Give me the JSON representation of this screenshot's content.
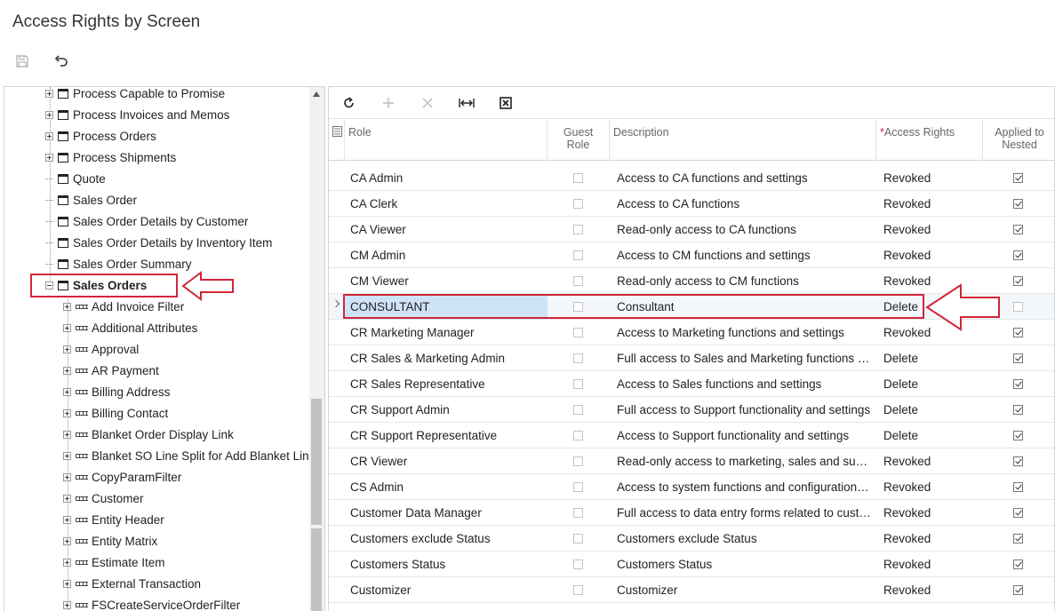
{
  "page": {
    "title": "Access Rights by Screen"
  },
  "toolbar": {
    "save_icon": "save-icon",
    "undo_icon": "undo-icon"
  },
  "tree": {
    "nodes": [
      {
        "label": "Process Capable to Promise",
        "kind": "screen",
        "expander": "plus"
      },
      {
        "label": "Process Invoices and Memos",
        "kind": "screen",
        "expander": "plus"
      },
      {
        "label": "Process Orders",
        "kind": "screen",
        "expander": "plus"
      },
      {
        "label": "Process Shipments",
        "kind": "screen",
        "expander": "plus"
      },
      {
        "label": "Quote",
        "kind": "screen",
        "expander": "none"
      },
      {
        "label": "Sales Order",
        "kind": "screen",
        "expander": "none"
      },
      {
        "label": "Sales Order Details by Customer",
        "kind": "screen",
        "expander": "none"
      },
      {
        "label": "Sales Order Details by Inventory Item",
        "kind": "screen",
        "expander": "none"
      },
      {
        "label": "Sales Order Summary",
        "kind": "screen",
        "expander": "none"
      },
      {
        "label": "Sales Orders",
        "kind": "screen",
        "expander": "minus",
        "selected": true
      },
      {
        "label": "Add Invoice Filter",
        "kind": "field",
        "expander": "plus"
      },
      {
        "label": "Additional Attributes",
        "kind": "field",
        "expander": "plus"
      },
      {
        "label": "Approval",
        "kind": "field",
        "expander": "plus"
      },
      {
        "label": "AR Payment",
        "kind": "field",
        "expander": "plus"
      },
      {
        "label": "Billing Address",
        "kind": "field",
        "expander": "plus"
      },
      {
        "label": "Billing Contact",
        "kind": "field",
        "expander": "plus"
      },
      {
        "label": "Blanket Order Display Link",
        "kind": "field",
        "expander": "plus"
      },
      {
        "label": "Blanket SO Line Split for Add Blanket Line",
        "kind": "field",
        "expander": "plus"
      },
      {
        "label": "CopyParamFilter",
        "kind": "field",
        "expander": "plus"
      },
      {
        "label": "Customer",
        "kind": "field",
        "expander": "plus"
      },
      {
        "label": "Entity Header",
        "kind": "field",
        "expander": "plus"
      },
      {
        "label": "Entity Matrix",
        "kind": "field",
        "expander": "plus"
      },
      {
        "label": "Estimate Item",
        "kind": "field",
        "expander": "plus"
      },
      {
        "label": "External Transaction",
        "kind": "field",
        "expander": "plus"
      },
      {
        "label": "FSCreateServiceOrderFilter",
        "kind": "field",
        "expander": "plus"
      }
    ]
  },
  "grid": {
    "toolbar": [
      "refresh-icon",
      "add-icon",
      "delete-icon",
      "fit-columns-icon",
      "export-excel-icon"
    ],
    "headers": {
      "role": "Role",
      "guest_role": "Guest Role",
      "description": "Description",
      "access_rights_required": "*",
      "access_rights": "Access Rights",
      "applied_to_nested": "Applied to Nested"
    },
    "rows": [
      {
        "role": "CA Admin",
        "guest": false,
        "description": "Access to CA functions and settings",
        "access": "Revoked",
        "nested": true
      },
      {
        "role": "CA Clerk",
        "guest": false,
        "description": "Access to CA functions",
        "access": "Revoked",
        "nested": true
      },
      {
        "role": "CA Viewer",
        "guest": false,
        "description": "Read-only access to CA functions",
        "access": "Revoked",
        "nested": true
      },
      {
        "role": "CM Admin",
        "guest": false,
        "description": "Access to CM functions and settings",
        "access": "Revoked",
        "nested": true
      },
      {
        "role": "CM Viewer",
        "guest": false,
        "description": "Read-only access to CM functions",
        "access": "Revoked",
        "nested": true
      },
      {
        "role": "CONSULTANT",
        "guest": false,
        "description": "Consultant",
        "access": "Delete",
        "nested": false,
        "selected": true
      },
      {
        "role": "CR Marketing Manager",
        "guest": false,
        "description": "Access to Marketing functions and settings",
        "access": "Revoked",
        "nested": true
      },
      {
        "role": "CR Sales & Marketing Admin",
        "guest": false,
        "description": "Full access to Sales and Marketing functions a...",
        "access": "Delete",
        "nested": true
      },
      {
        "role": "CR Sales Representative",
        "guest": false,
        "description": "Access to Sales functions and settings",
        "access": "Delete",
        "nested": true
      },
      {
        "role": "CR Support Admin",
        "guest": false,
        "description": "Full access to Support functionality and settings",
        "access": "Delete",
        "nested": true
      },
      {
        "role": "CR Support Representative",
        "guest": false,
        "description": "Access to Support functionality and settings",
        "access": "Delete",
        "nested": true
      },
      {
        "role": "CR Viewer",
        "guest": false,
        "description": "Read-only access to marketing, sales and sup...",
        "access": "Revoked",
        "nested": true
      },
      {
        "role": "CS Admin",
        "guest": false,
        "description": "Access to system functions and configuration i...",
        "access": "Revoked",
        "nested": true
      },
      {
        "role": "Customer Data Manager",
        "guest": false,
        "description": "Full access to data entry forms related to custo...",
        "access": "Revoked",
        "nested": true
      },
      {
        "role": "Customers exclude Status",
        "guest": false,
        "description": "Customers exclude Status",
        "access": "Revoked",
        "nested": true
      },
      {
        "role": "Customers Status",
        "guest": false,
        "description": "Customers Status",
        "access": "Revoked",
        "nested": true
      },
      {
        "role": "Customizer",
        "guest": false,
        "description": "Customizer",
        "access": "Revoked",
        "nested": true
      }
    ]
  },
  "annotations": {
    "highlight_color": "#d1263a"
  }
}
